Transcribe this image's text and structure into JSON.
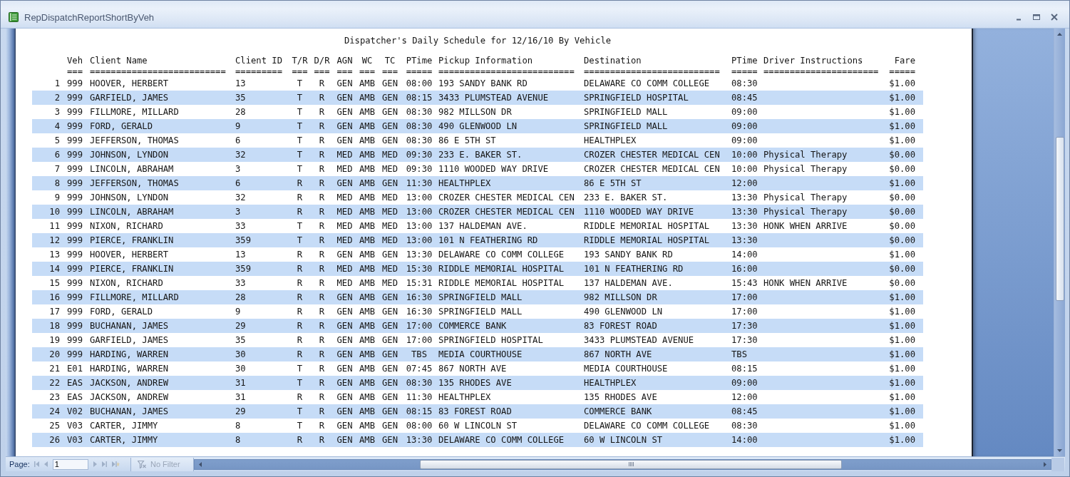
{
  "window": {
    "title": "RepDispatchReportShortByVeh"
  },
  "report": {
    "title": "Dispatcher's Daily Schedule for 12/16/10 By Vehicle",
    "columns": [
      {
        "label": "Veh",
        "rule": "==="
      },
      {
        "label": "Client Name",
        "rule": "=========================="
      },
      {
        "label": "Client ID",
        "rule": "========="
      },
      {
        "label": "T/R",
        "rule": "==="
      },
      {
        "label": "D/R",
        "rule": "==="
      },
      {
        "label": "AGN",
        "rule": "==="
      },
      {
        "label": "WC",
        "rule": "==="
      },
      {
        "label": "TC",
        "rule": "==="
      },
      {
        "label": "PTime",
        "rule": "====="
      },
      {
        "label": "Pickup Information",
        "rule": "=========================="
      },
      {
        "label": "Destination",
        "rule": "=========================="
      },
      {
        "label": "PTime",
        "rule": "====="
      },
      {
        "label": "Driver Instructions",
        "rule": "======================"
      },
      {
        "label": "Fare",
        "rule": "====="
      }
    ],
    "rows": [
      {
        "line": "1",
        "veh": "999",
        "client_name": "HOOVER, HERBERT",
        "client_id": "13",
        "t_r": "T",
        "d_r": "R",
        "agn": "GEN",
        "wc": "AMB",
        "tc": "GEN",
        "ptime": "08:00",
        "pickup_information": "193 SANDY BANK RD",
        "destination": "DELAWARE CO COMM COLLEGE",
        "ptime_2": "08:30",
        "fare": "$1.00"
      },
      {
        "line": "2",
        "veh": "999",
        "client_name": "GARFIELD, JAMES",
        "client_id": "35",
        "t_r": "T",
        "d_r": "R",
        "agn": "GEN",
        "wc": "AMB",
        "tc": "GEN",
        "ptime": "08:15",
        "pickup_information": "3433 PLUMSTEAD AVENUE",
        "destination": "SPRINGFIELD HOSPITAL",
        "ptime_2": "08:45",
        "fare": "$1.00"
      },
      {
        "line": "3",
        "veh": "999",
        "client_name": "FILLMORE, MILLARD",
        "client_id": "28",
        "t_r": "T",
        "d_r": "R",
        "agn": "GEN",
        "wc": "AMB",
        "tc": "GEN",
        "ptime": "08:30",
        "pickup_information": "982 MILLSON DR",
        "destination": "SPRINGFIELD MALL",
        "ptime_2": "09:00",
        "fare": "$1.00"
      },
      {
        "line": "4",
        "veh": "999",
        "client_name": "FORD, GERALD",
        "client_id": "9",
        "t_r": "T",
        "d_r": "R",
        "agn": "GEN",
        "wc": "AMB",
        "tc": "GEN",
        "ptime": "08:30",
        "pickup_information": "490 GLENWOOD LN",
        "destination": "SPRINGFIELD MALL",
        "ptime_2": "09:00",
        "fare": "$1.00"
      },
      {
        "line": "5",
        "veh": "999",
        "client_name": "JEFFERSON, THOMAS",
        "client_id": "6",
        "t_r": "T",
        "d_r": "R",
        "agn": "GEN",
        "wc": "AMB",
        "tc": "GEN",
        "ptime": "08:30",
        "pickup_information": "86 E 5TH ST",
        "destination": "HEALTHPLEX",
        "ptime_2": "09:00",
        "fare": "$1.00"
      },
      {
        "line": "6",
        "veh": "999",
        "client_name": "JOHNSON, LYNDON",
        "client_id": "32",
        "t_r": "T",
        "d_r": "R",
        "agn": "MED",
        "wc": "AMB",
        "tc": "MED",
        "ptime": "09:30",
        "pickup_information": "233 E. BAKER ST.",
        "destination": "CROZER CHESTER MEDICAL CEN",
        "ptime_2": "10:00",
        "driver_instructions": "Physical Therapy",
        "fare": "$0.00"
      },
      {
        "line": "7",
        "veh": "999",
        "client_name": "LINCOLN, ABRAHAM",
        "client_id": "3",
        "t_r": "T",
        "d_r": "R",
        "agn": "MED",
        "wc": "AMB",
        "tc": "MED",
        "ptime": "09:30",
        "pickup_information": "1110 WOODED WAY DRIVE",
        "destination": "CROZER CHESTER MEDICAL CEN",
        "ptime_2": "10:00",
        "driver_instructions": "Physical Therapy",
        "fare": "$0.00"
      },
      {
        "line": "8",
        "veh": "999",
        "client_name": "JEFFERSON, THOMAS",
        "client_id": "6",
        "t_r": "R",
        "d_r": "R",
        "agn": "GEN",
        "wc": "AMB",
        "tc": "GEN",
        "ptime": "11:30",
        "pickup_information": "HEALTHPLEX",
        "destination": "86 E 5TH ST",
        "ptime_2": "12:00",
        "fare": "$1.00"
      },
      {
        "line": "9",
        "veh": "999",
        "client_name": "JOHNSON, LYNDON",
        "client_id": "32",
        "t_r": "R",
        "d_r": "R",
        "agn": "MED",
        "wc": "AMB",
        "tc": "MED",
        "ptime": "13:00",
        "pickup_information": "CROZER CHESTER MEDICAL CEN",
        "destination": "233 E. BAKER ST.",
        "ptime_2": "13:30",
        "driver_instructions": "Physical Therapy",
        "fare": "$0.00"
      },
      {
        "line": "10",
        "veh": "999",
        "client_name": "LINCOLN, ABRAHAM",
        "client_id": "3",
        "t_r": "R",
        "d_r": "R",
        "agn": "MED",
        "wc": "AMB",
        "tc": "MED",
        "ptime": "13:00",
        "pickup_information": "CROZER CHESTER MEDICAL CEN",
        "destination": "1110 WOODED WAY DRIVE",
        "ptime_2": "13:30",
        "driver_instructions": "Physical Therapy",
        "fare": "$0.00"
      },
      {
        "line": "11",
        "veh": "999",
        "client_name": "NIXON, RICHARD",
        "client_id": "33",
        "t_r": "T",
        "d_r": "R",
        "agn": "MED",
        "wc": "AMB",
        "tc": "MED",
        "ptime": "13:00",
        "pickup_information": "137 HALDEMAN AVE.",
        "destination": "RIDDLE MEMORIAL HOSPITAL",
        "ptime_2": "13:30",
        "driver_instructions": "HONK WHEN ARRIVE",
        "fare": "$0.00"
      },
      {
        "line": "12",
        "veh": "999",
        "client_name": "PIERCE, FRANKLIN",
        "client_id": "359",
        "t_r": "T",
        "d_r": "R",
        "agn": "MED",
        "wc": "AMB",
        "tc": "MED",
        "ptime": "13:00",
        "pickup_information": "101 N FEATHERING RD",
        "destination": "RIDDLE MEMORIAL HOSPITAL",
        "ptime_2": "13:30",
        "fare": "$0.00"
      },
      {
        "line": "13",
        "veh": "999",
        "client_name": "HOOVER, HERBERT",
        "client_id": "13",
        "t_r": "R",
        "d_r": "R",
        "agn": "GEN",
        "wc": "AMB",
        "tc": "GEN",
        "ptime": "13:30",
        "pickup_information": "DELAWARE CO COMM COLLEGE",
        "destination": "193 SANDY BANK RD",
        "ptime_2": "14:00",
        "fare": "$1.00"
      },
      {
        "line": "14",
        "veh": "999",
        "client_name": "PIERCE, FRANKLIN",
        "client_id": "359",
        "t_r": "R",
        "d_r": "R",
        "agn": "MED",
        "wc": "AMB",
        "tc": "MED",
        "ptime": "15:30",
        "pickup_information": "RIDDLE MEMORIAL HOSPITAL",
        "destination": "101 N FEATHERING RD",
        "ptime_2": "16:00",
        "fare": "$0.00"
      },
      {
        "line": "15",
        "veh": "999",
        "client_name": "NIXON, RICHARD",
        "client_id": "33",
        "t_r": "R",
        "d_r": "R",
        "agn": "MED",
        "wc": "AMB",
        "tc": "MED",
        "ptime": "15:31",
        "pickup_information": "RIDDLE MEMORIAL HOSPITAL",
        "destination": "137 HALDEMAN AVE.",
        "ptime_2": "15:43",
        "driver_instructions": "HONK WHEN ARRIVE",
        "fare": "$0.00"
      },
      {
        "line": "16",
        "veh": "999",
        "client_name": "FILLMORE, MILLARD",
        "client_id": "28",
        "t_r": "R",
        "d_r": "R",
        "agn": "GEN",
        "wc": "AMB",
        "tc": "GEN",
        "ptime": "16:30",
        "pickup_information": "SPRINGFIELD MALL",
        "destination": "982 MILLSON DR",
        "ptime_2": "17:00",
        "fare": "$1.00"
      },
      {
        "line": "17",
        "veh": "999",
        "client_name": "FORD, GERALD",
        "client_id": "9",
        "t_r": "R",
        "d_r": "R",
        "agn": "GEN",
        "wc": "AMB",
        "tc": "GEN",
        "ptime": "16:30",
        "pickup_information": "SPRINGFIELD MALL",
        "destination": "490 GLENWOOD LN",
        "ptime_2": "17:00",
        "fare": "$1.00"
      },
      {
        "line": "18",
        "veh": "999",
        "client_name": "BUCHANAN, JAMES",
        "client_id": "29",
        "t_r": "R",
        "d_r": "R",
        "agn": "GEN",
        "wc": "AMB",
        "tc": "GEN",
        "ptime": "17:00",
        "pickup_information": "COMMERCE BANK",
        "destination": "83 FOREST ROAD",
        "ptime_2": "17:30",
        "fare": "$1.00"
      },
      {
        "line": "19",
        "veh": "999",
        "client_name": "GARFIELD, JAMES",
        "client_id": "35",
        "t_r": "R",
        "d_r": "R",
        "agn": "GEN",
        "wc": "AMB",
        "tc": "GEN",
        "ptime": "17:00",
        "pickup_information": "SPRINGFIELD HOSPITAL",
        "destination": "3433 PLUMSTEAD AVENUE",
        "ptime_2": "17:30",
        "fare": "$1.00"
      },
      {
        "line": "20",
        "veh": "999",
        "client_name": "HARDING, WARREN",
        "client_id": "30",
        "t_r": "R",
        "d_r": "R",
        "agn": "GEN",
        "wc": "AMB",
        "tc": "GEN",
        "ptime": "TBS",
        "pickup_information": "MEDIA COURTHOUSE",
        "destination": "867 NORTH AVE",
        "ptime_2": "TBS",
        "fare": "$1.00"
      },
      {
        "line": "21",
        "veh": "E01",
        "client_name": "HARDING, WARREN",
        "client_id": "30",
        "t_r": "T",
        "d_r": "R",
        "agn": "GEN",
        "wc": "AMB",
        "tc": "GEN",
        "ptime": "07:45",
        "pickup_information": "867 NORTH AVE",
        "destination": "MEDIA COURTHOUSE",
        "ptime_2": "08:15",
        "fare": "$1.00"
      },
      {
        "line": "22",
        "veh": "EAS",
        "client_name": "JACKSON, ANDREW",
        "client_id": "31",
        "t_r": "T",
        "d_r": "R",
        "agn": "GEN",
        "wc": "AMB",
        "tc": "GEN",
        "ptime": "08:30",
        "pickup_information": "135 RHODES AVE",
        "destination": "HEALTHPLEX",
        "ptime_2": "09:00",
        "fare": "$1.00"
      },
      {
        "line": "23",
        "veh": "EAS",
        "client_name": "JACKSON, ANDREW",
        "client_id": "31",
        "t_r": "R",
        "d_r": "R",
        "agn": "GEN",
        "wc": "AMB",
        "tc": "GEN",
        "ptime": "11:30",
        "pickup_information": "HEALTHPLEX",
        "destination": "135 RHODES AVE",
        "ptime_2": "12:00",
        "fare": "$1.00"
      },
      {
        "line": "24",
        "veh": "V02",
        "client_name": "BUCHANAN, JAMES",
        "client_id": "29",
        "t_r": "T",
        "d_r": "R",
        "agn": "GEN",
        "wc": "AMB",
        "tc": "GEN",
        "ptime": "08:15",
        "pickup_information": "83 FOREST ROAD",
        "destination": "COMMERCE BANK",
        "ptime_2": "08:45",
        "fare": "$1.00"
      },
      {
        "line": "25",
        "veh": "V03",
        "client_name": "CARTER, JIMMY",
        "client_id": "8",
        "t_r": "T",
        "d_r": "R",
        "agn": "GEN",
        "wc": "AMB",
        "tc": "GEN",
        "ptime": "08:00",
        "pickup_information": "60 W LINCOLN ST",
        "destination": "DELAWARE CO COMM COLLEGE",
        "ptime_2": "08:30",
        "fare": "$1.00"
      },
      {
        "line": "26",
        "veh": "V03",
        "client_name": "CARTER, JIMMY",
        "client_id": "8",
        "t_r": "R",
        "d_r": "R",
        "agn": "GEN",
        "wc": "AMB",
        "tc": "GEN",
        "ptime": "13:30",
        "pickup_information": "DELAWARE CO COMM COLLEGE",
        "destination": "60 W LINCOLN ST",
        "ptime_2": "14:00",
        "fare": "$1.00"
      }
    ]
  },
  "navigation": {
    "label": "Page:",
    "buttons": [
      {
        "kind": "first",
        "disabled": true
      },
      {
        "kind": "previous",
        "disabled": true
      },
      {
        "kind": "next",
        "disabled": true
      },
      {
        "kind": "last",
        "disabled": true
      },
      {
        "kind": "new",
        "disabled": true
      }
    ],
    "page": "1",
    "filter": {
      "label": "No Filter",
      "disabled": true
    }
  }
}
